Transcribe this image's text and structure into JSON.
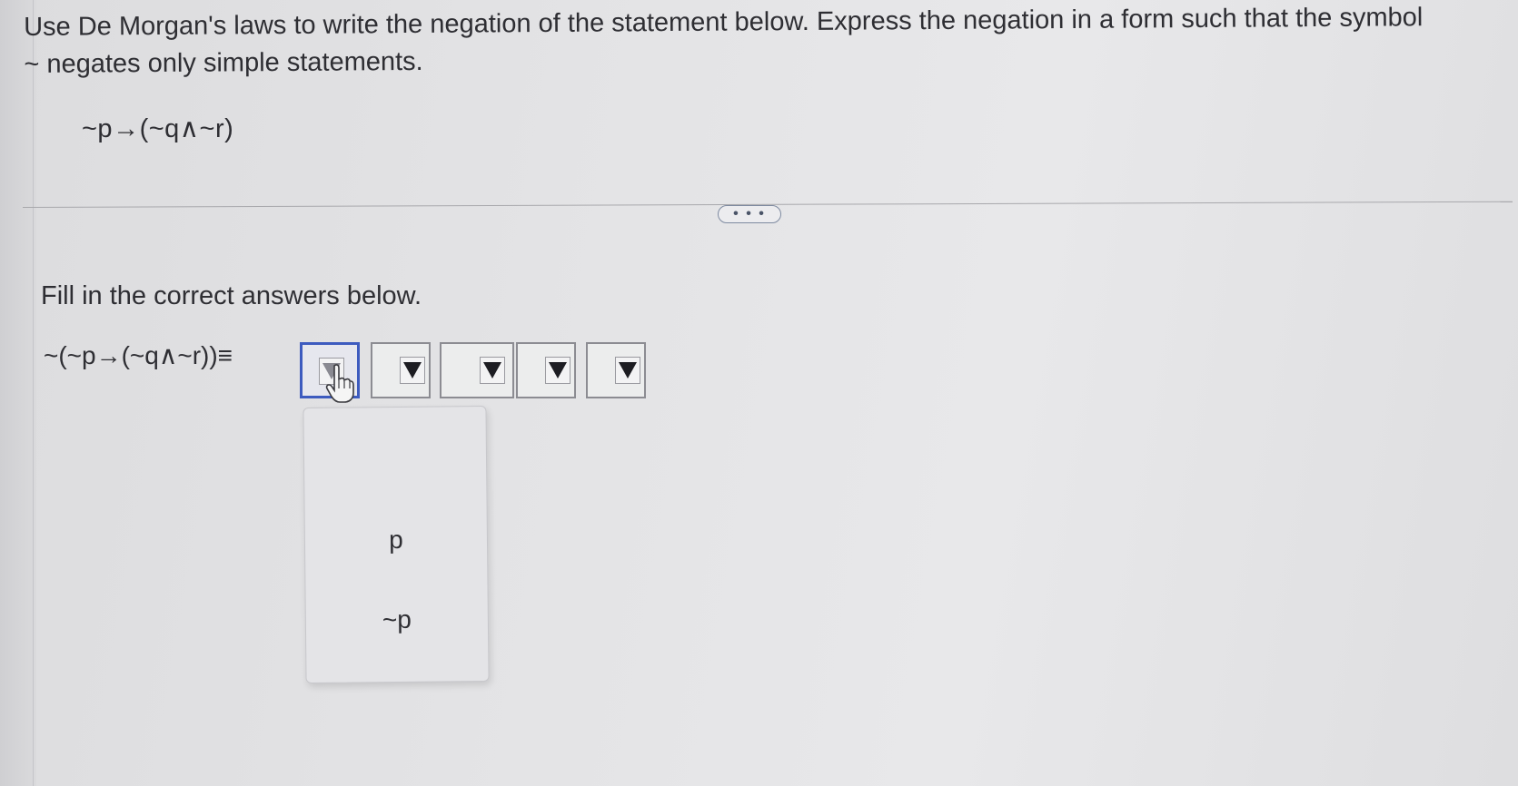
{
  "question": {
    "line1": "Use De Morgan's laws to write the negation of the statement below. Express the negation in a form such that the symbol",
    "line2": "~ negates only simple statements.",
    "statement": "~p→(~q∧~r)"
  },
  "more_button": {
    "label": "• • •"
  },
  "answer": {
    "instruction": "Fill in the correct answers below.",
    "expression": "~(~p→(~q∧~r))≡",
    "dropdowns": [
      {
        "selected": "",
        "active": true
      },
      {
        "selected": "",
        "active": false
      },
      {
        "selected": "",
        "active": false
      },
      {
        "selected": "",
        "active": false
      },
      {
        "selected": "",
        "active": false
      }
    ]
  },
  "menu": {
    "options": [
      "p",
      "~p"
    ]
  },
  "colors": {
    "active_border": "#3d5bbf",
    "text": "#2e2e33",
    "background": "#e3e3e5"
  }
}
